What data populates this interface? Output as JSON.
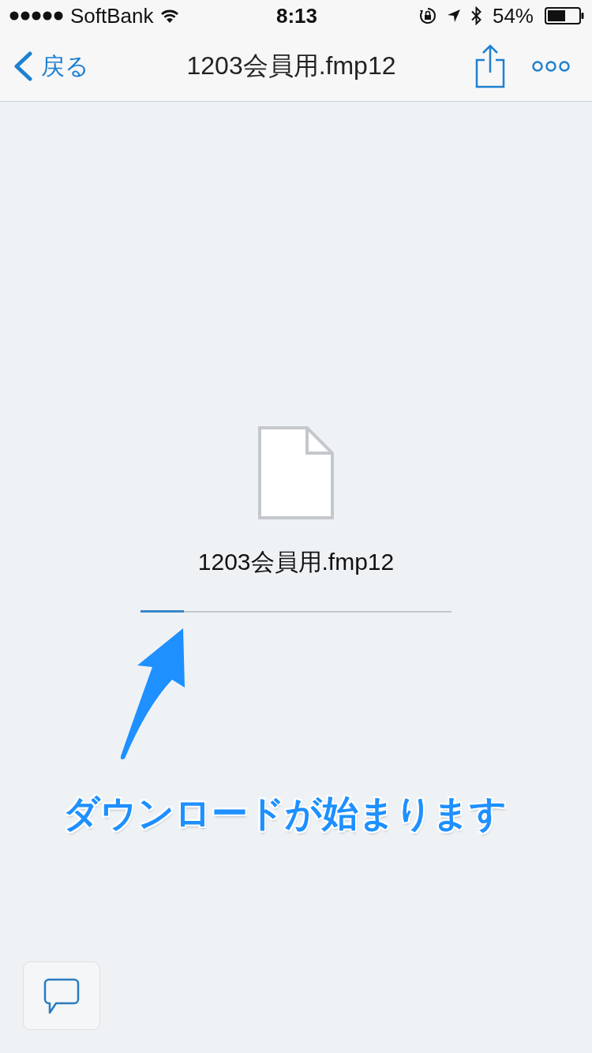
{
  "status_bar": {
    "carrier": "SoftBank",
    "time": "8:13",
    "battery": "54%"
  },
  "nav_bar": {
    "back_label": "戻る",
    "title": "1203会員用.fmp12"
  },
  "download": {
    "file_name": "1203会員用.fmp12",
    "level": 0.14
  },
  "annotation": {
    "text": "ダウンロードが始まります"
  }
}
